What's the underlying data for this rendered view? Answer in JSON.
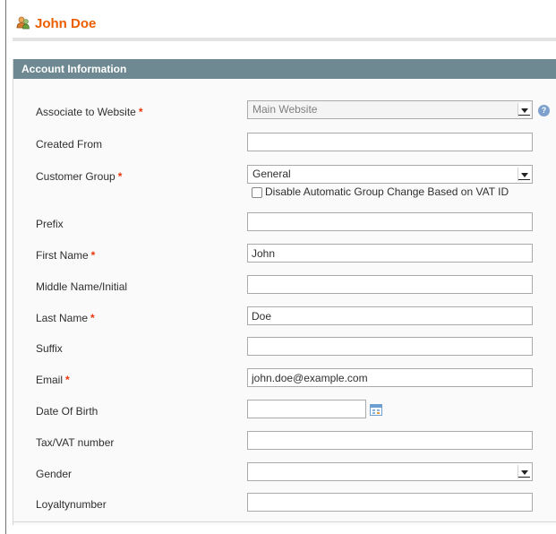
{
  "header": {
    "title": "John Doe",
    "icon": "customer-user-icon"
  },
  "section": {
    "title": "Account Information"
  },
  "fields": {
    "website": {
      "label": "Associate to Website",
      "required": "*",
      "value": "Main Website"
    },
    "created_from": {
      "label": "Created From",
      "value": ""
    },
    "group": {
      "label": "Customer Group",
      "required": "*",
      "value": "General",
      "checkbox_label": "Disable Automatic Group Change Based on VAT ID"
    },
    "prefix": {
      "label": "Prefix",
      "value": ""
    },
    "first_name": {
      "label": "First Name",
      "required": "*",
      "value": "John"
    },
    "middle_name": {
      "label": "Middle Name/Initial",
      "value": ""
    },
    "last_name": {
      "label": "Last Name",
      "required": "*",
      "value": "Doe"
    },
    "suffix": {
      "label": "Suffix",
      "value": ""
    },
    "email": {
      "label": "Email",
      "required": "*",
      "value": "john.doe@example.com"
    },
    "dob": {
      "label": "Date Of Birth",
      "value": ""
    },
    "taxvat": {
      "label": "Tax/VAT number",
      "value": ""
    },
    "gender": {
      "label": "Gender",
      "value": ""
    },
    "loyalty": {
      "label": "Loyaltynumber",
      "value": ""
    }
  },
  "colors": {
    "title": "#eb5e00",
    "section_header": "#6f8992",
    "required": "#eb340a"
  }
}
